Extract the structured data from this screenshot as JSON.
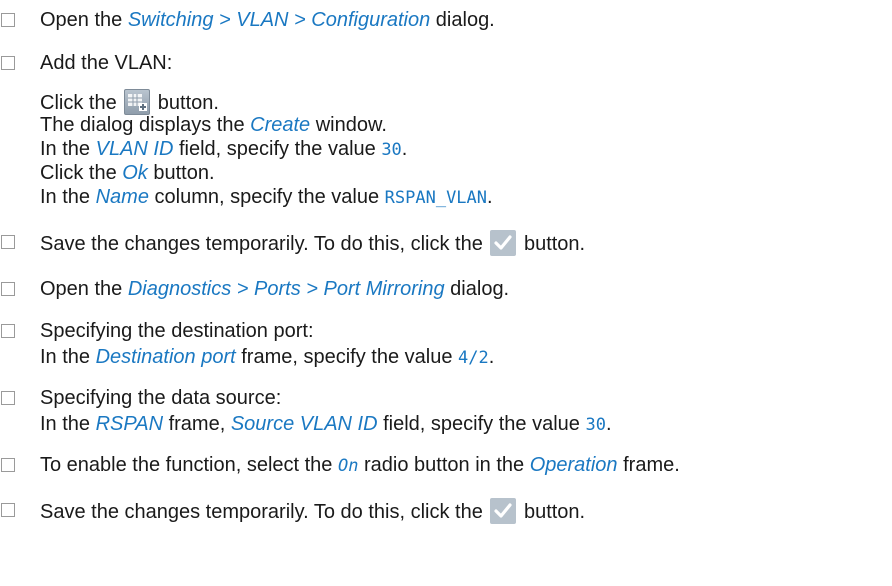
{
  "steps": [
    {
      "a": "Open the ",
      "b": "Switching > VLAN > Configuration",
      "c": " dialog."
    },
    {
      "text": "Add the VLAN:",
      "lines": {
        "l1a": "Click the ",
        "l1b": " button.",
        "l2a": "The dialog displays the ",
        "l2b": "Create",
        "l2c": " window.",
        "l3a": "In the ",
        "l3b": "VLAN ID",
        "l3c": " field, specify the value ",
        "l3d": "30",
        "l3e": ".",
        "l4a": "Click the ",
        "l4b": "Ok",
        "l4c": " button.",
        "l5a": "In the ",
        "l5b": "Name",
        "l5c": " column, specify the value ",
        "l5d": "RSPAN_VLAN",
        "l5e": "."
      }
    },
    {
      "a": "Save the changes temporarily. To do this, click the ",
      "b": " button."
    },
    {
      "a": "Open the ",
      "b": "Diagnostics > Ports > Port Mirroring",
      "c": " dialog."
    },
    {
      "a": "Specifying the destination port:",
      "l2a": "In the ",
      "l2b": "Destination port",
      "l2c": " frame, specify the value ",
      "l2d": "4/2",
      "l2e": "."
    },
    {
      "a": "Specifying the data source:",
      "l2a": "In the ",
      "l2b": "RSPAN",
      "l2c": " frame, ",
      "l2d": "Source VLAN ID",
      "l2e": " field, specify the value ",
      "l2f": "30",
      "l2g": "."
    },
    {
      "a": "To enable the function, select the ",
      "b": "On",
      "c": " radio button in the ",
      "d": "Operation",
      "e": " frame."
    },
    {
      "a": "Save the changes temporarily. To do this, click the ",
      "b": " button."
    }
  ],
  "icons": {
    "table_add": "table-add-icon",
    "checkmark": "checkmark-icon"
  },
  "colors": {
    "link": "#1a78c2",
    "text": "#1a1a1a",
    "checkbox_border": "#9a9a9a",
    "check_button_bg": "#b7c2cc"
  }
}
